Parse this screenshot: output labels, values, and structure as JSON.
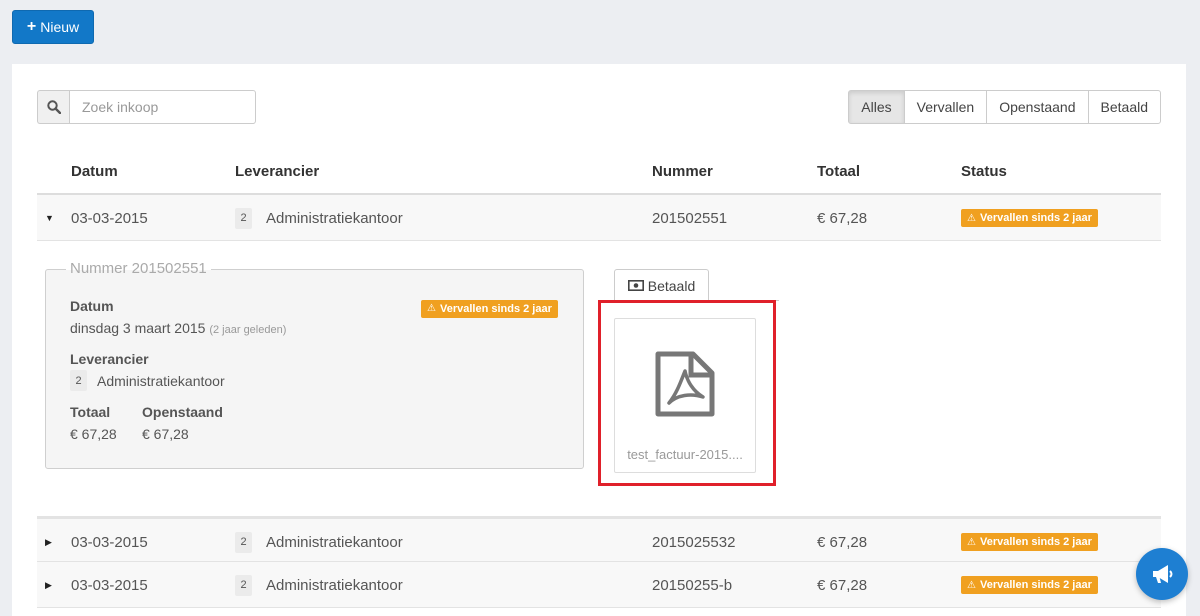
{
  "toolbar": {
    "new_label": "Nieuw",
    "new_icon": "plus-icon"
  },
  "search": {
    "placeholder": "Zoek inkoop",
    "icon": "search-icon"
  },
  "filters": [
    "Alles",
    "Vervallen",
    "Openstaand",
    "Betaald"
  ],
  "active_filter": "Alles",
  "table": {
    "headers": {
      "datum": "Datum",
      "leverancier": "Leverancier",
      "nummer": "Nummer",
      "totaal": "Totaal",
      "status": "Status"
    },
    "rows": [
      {
        "datum": "03-03-2015",
        "badge": "2",
        "leverancier": "Administratiekantoor",
        "nummer": "201502551",
        "totaal": "€ 67,28",
        "status": "Vervallen sinds 2 jaar",
        "expanded": true
      },
      {
        "datum": "03-03-2015",
        "badge": "2",
        "leverancier": "Administratiekantoor",
        "nummer": "2015025532",
        "totaal": "€ 67,28",
        "status": "Vervallen sinds 2 jaar",
        "expanded": false
      },
      {
        "datum": "03-03-2015",
        "badge": "2",
        "leverancier": "Administratiekantoor",
        "nummer": "20150255-b",
        "totaal": "€ 67,28",
        "status": "Vervallen sinds 2 jaar",
        "expanded": false
      }
    ]
  },
  "detail": {
    "legend": "Nummer 201502551",
    "datum_label": "Datum",
    "datum_value": "dinsdag 3 maart 2015",
    "datum_relative": "(2 jaar geleden)",
    "status": "Vervallen sinds 2 jaar",
    "leverancier_label": "Leverancier",
    "leverancier_badge": "2",
    "leverancier_value": "Administratiekantoor",
    "totaal_label": "Totaal",
    "totaal_value": "€ 67,28",
    "openstaand_label": "Openstaand",
    "openstaand_value": "€ 67,28",
    "tab_label": "Betaald",
    "file_name": "test_factuur-2015...."
  },
  "colors": {
    "primary": "#1278c8",
    "warning": "#f0a020",
    "highlight": "#e0202a",
    "fab": "#1e7fd2"
  }
}
